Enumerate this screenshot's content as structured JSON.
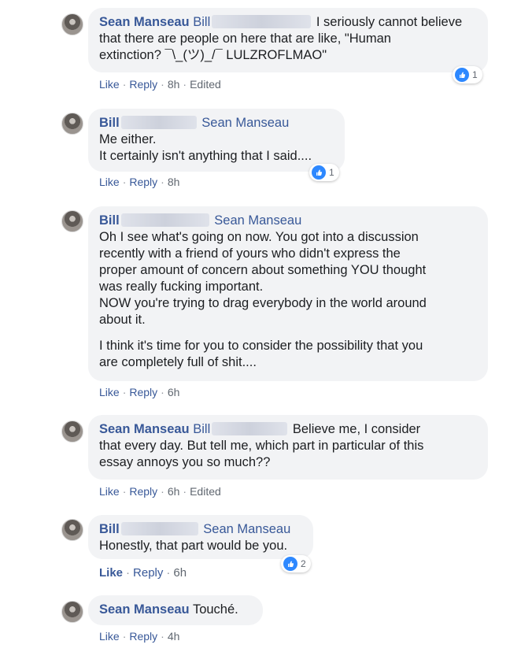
{
  "comments": [
    {
      "name": "Sean Manseau",
      "mention": "Bill",
      "lines": [
        "I seriously cannot believe",
        "that there are people on here that are like, \"Human",
        "extinction? ¯\\_(ツ)_/¯ LULZROFLMAO\""
      ],
      "actions": {
        "like": "Like",
        "reply": "Reply",
        "time": "8h",
        "edited": "Edited"
      },
      "reaction_count": "1"
    },
    {
      "name": "Bill",
      "mention": "Sean Manseau",
      "lines": [
        "Me either.",
        "It certainly isn't anything that I said...."
      ],
      "actions": {
        "like": "Like",
        "reply": "Reply",
        "time": "8h"
      },
      "reaction_count": "1"
    },
    {
      "name": "Bill",
      "mention": "Sean Manseau",
      "lines": [
        "Oh I see what's going on now. You got into a discussion",
        "recently with a friend of yours who didn't express the",
        "proper amount of concern about something YOU thought",
        "was really fucking important.",
        "NOW you're trying to drag everybody in the world around",
        "about it."
      ],
      "lines2": [
        "I think it's time for you to consider the possibility that you",
        "are completely full of shit...."
      ],
      "actions": {
        "like": "Like",
        "reply": "Reply",
        "time": "6h"
      }
    },
    {
      "name": "Sean Manseau",
      "mention": "Bill",
      "lines": [
        "Believe me, I consider",
        "that every day. But tell me, which part in particular of this",
        "essay annoys you so much??"
      ],
      "actions": {
        "like": "Like",
        "reply": "Reply",
        "time": "6h",
        "edited": "Edited"
      }
    },
    {
      "name": "Bill",
      "mention": "Sean Manseau",
      "lines": [
        "Honestly, that part would be you."
      ],
      "actions": {
        "like": "Like",
        "reply": "Reply",
        "time": "6h"
      },
      "reaction_count": "2"
    },
    {
      "name": "Sean Manseau",
      "text": "Touché.",
      "actions": {
        "like": "Like",
        "reply": "Reply",
        "time": "4h"
      }
    }
  ],
  "icons": {
    "avatar": "avatar-photo",
    "reaction": "thumbs-up-icon"
  },
  "colors": {
    "name": "#385898",
    "bubble": "#f2f3f5",
    "like_blue": "#2d88ff",
    "meta": "#606770"
  }
}
